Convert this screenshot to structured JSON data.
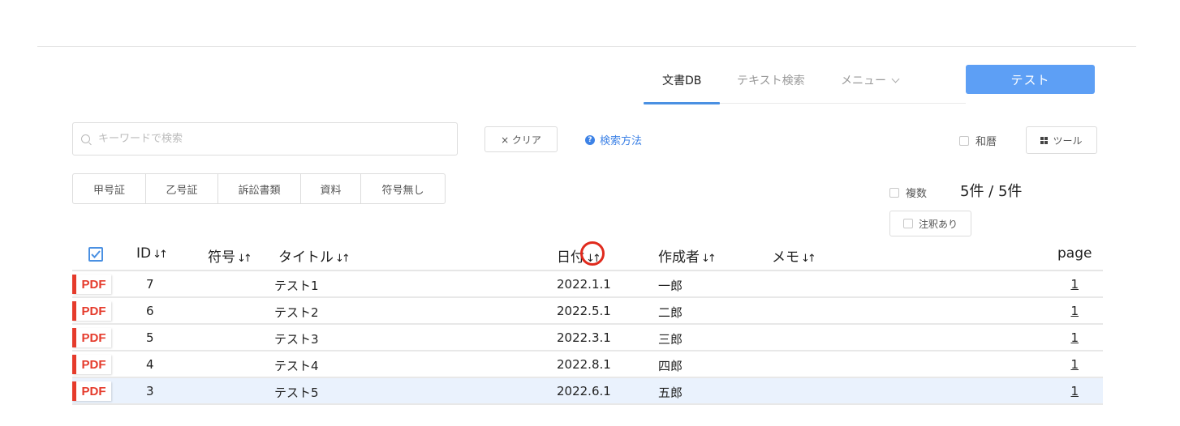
{
  "nav": {
    "items": [
      {
        "label": "文書DB",
        "active": true
      },
      {
        "label": "テキスト検索",
        "active": false
      },
      {
        "label": "メニュー",
        "active": false
      }
    ],
    "test_button": "テスト"
  },
  "search": {
    "placeholder": "キーワードで検索",
    "clear_label": "× クリア",
    "help_label": "検索方法"
  },
  "options": {
    "wareki_label": "和暦",
    "tool_label": "ツール",
    "multi_label": "複数",
    "annotation_label": "注釈あり",
    "result_count": "5件 / 5件"
  },
  "filter_tabs": [
    "甲号証",
    "乙号証",
    "訴訟書類",
    "資料",
    "符号無し"
  ],
  "table": {
    "columns": [
      "ID",
      "符号",
      "タイトル",
      "日付",
      "作成者",
      "メモ",
      "page"
    ],
    "sort_glyph": "↓↑",
    "pdf_label": "PDF",
    "rows": [
      {
        "id": "7",
        "code": "",
        "title": "テスト1",
        "date": "2022.1.1",
        "author": "一郎",
        "memo": "",
        "page": "1",
        "selected": false
      },
      {
        "id": "6",
        "code": "",
        "title": "テスト2",
        "date": "2022.5.1",
        "author": "二郎",
        "memo": "",
        "page": "1",
        "selected": false
      },
      {
        "id": "5",
        "code": "",
        "title": "テスト3",
        "date": "2022.3.1",
        "author": "三郎",
        "memo": "",
        "page": "1",
        "selected": false
      },
      {
        "id": "4",
        "code": "",
        "title": "テスト4",
        "date": "2022.8.1",
        "author": "四郎",
        "memo": "",
        "page": "1",
        "selected": false
      },
      {
        "id": "3",
        "code": "",
        "title": "テスト5",
        "date": "2022.6.1",
        "author": "五郎",
        "memo": "",
        "page": "1",
        "selected": true
      }
    ]
  },
  "colors": {
    "accent": "#4a90e2",
    "button": "#5d9ff5",
    "pdf_red": "#e53b2c",
    "highlight_ring": "#e02a1d",
    "selected_row": "#eaf2fd"
  }
}
